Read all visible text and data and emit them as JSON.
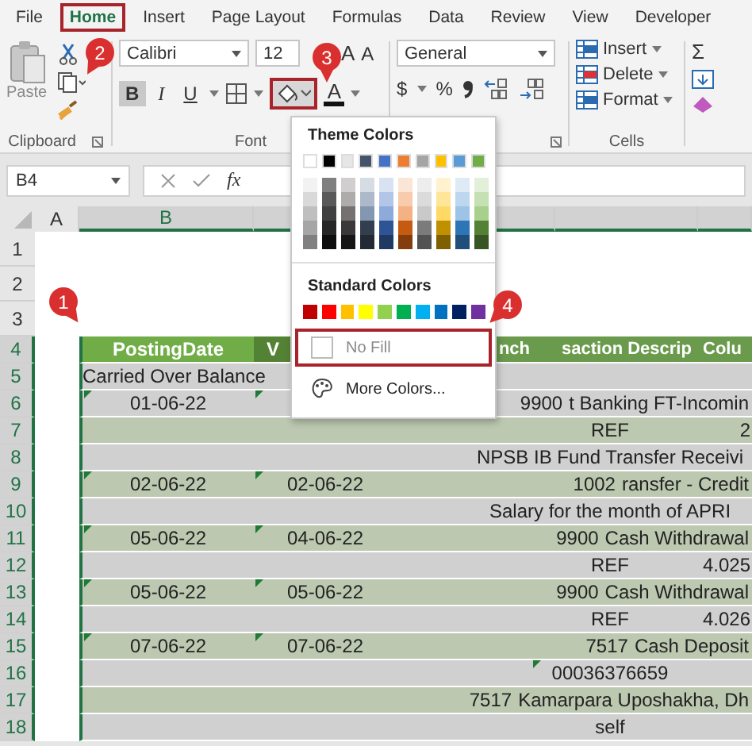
{
  "tabs": [
    {
      "label": "File",
      "selected": false,
      "highlighted": false
    },
    {
      "label": "Home",
      "selected": true,
      "highlighted": true
    },
    {
      "label": "Insert",
      "selected": false,
      "highlighted": false
    },
    {
      "label": "Page Layout",
      "selected": false,
      "highlighted": false
    },
    {
      "label": "Formulas",
      "selected": false,
      "highlighted": false
    },
    {
      "label": "Data",
      "selected": false,
      "highlighted": false
    },
    {
      "label": "Review",
      "selected": false,
      "highlighted": false
    },
    {
      "label": "View",
      "selected": false,
      "highlighted": false
    },
    {
      "label": "Developer",
      "selected": false,
      "highlighted": false
    }
  ],
  "clipboard": {
    "paste": "Paste",
    "label": "Clipboard"
  },
  "font": {
    "name": "Calibri",
    "size": "12",
    "grow": "A",
    "shrink": "A",
    "bold": "B",
    "italic": "I",
    "underline": "U",
    "fill_highlighted": true,
    "color_letter": "A",
    "label": "Font"
  },
  "number": {
    "format": "General",
    "currency": "$",
    "percent": "%"
  },
  "cells": {
    "items": [
      "Insert",
      "Delete",
      "Format"
    ],
    "label": "Cells"
  },
  "editing": {
    "sum": "Σ"
  },
  "formula_bar": {
    "name_box": "B4",
    "fx": "fx"
  },
  "column_headers": [
    "A",
    "B"
  ],
  "rows": [
    {
      "num": "1",
      "kind": "blank",
      "selected": false
    },
    {
      "num": "2",
      "kind": "blank",
      "selected": false
    },
    {
      "num": "3",
      "kind": "blank",
      "selected": false
    },
    {
      "num": "4",
      "kind": "header",
      "selected": true,
      "b": "PostingDate",
      "c": "V",
      "d": "nch",
      "e": "saction Descrip",
      "f": "Colu"
    },
    {
      "num": "5",
      "kind": "data",
      "selected": true,
      "band": false,
      "b": "Carried Over Balance"
    },
    {
      "num": "6",
      "kind": "data",
      "selected": true,
      "band": false,
      "b": "01-06-22",
      "d": "9900",
      "e": "t Banking FT-Incomin",
      "flag_b": true,
      "flag_c": true
    },
    {
      "num": "7",
      "kind": "data",
      "selected": true,
      "band": true,
      "e": "REF",
      "f": "2"
    },
    {
      "num": "8",
      "kind": "data",
      "selected": true,
      "band": false,
      "e": "NPSB IB Fund Transfer Receivi"
    },
    {
      "num": "9",
      "kind": "data",
      "selected": true,
      "band": true,
      "b": "02-06-22",
      "c": "02-06-22",
      "d": "1002",
      "e": "ransfer - Credit",
      "flag_b": true,
      "flag_c": true
    },
    {
      "num": "10",
      "kind": "data",
      "selected": true,
      "band": false,
      "e": "Salary for the month of APRI"
    },
    {
      "num": "11",
      "kind": "data",
      "selected": true,
      "band": true,
      "b": "05-06-22",
      "c": "04-06-22",
      "d": "9900",
      "e": "Cash Withdrawal",
      "flag_b": true,
      "flag_c": true
    },
    {
      "num": "12",
      "kind": "data",
      "selected": true,
      "band": false,
      "e": "REF",
      "f": "4.025"
    },
    {
      "num": "13",
      "kind": "data",
      "selected": true,
      "band": true,
      "b": "05-06-22",
      "c": "05-06-22",
      "d": "9900",
      "e": "Cash Withdrawal",
      "flag_b": true,
      "flag_c": true
    },
    {
      "num": "14",
      "kind": "data",
      "selected": true,
      "band": false,
      "e": "REF",
      "f": "4.026"
    },
    {
      "num": "15",
      "kind": "data",
      "selected": true,
      "band": true,
      "b": "07-06-22",
      "c": "07-06-22",
      "d": "7517",
      "e": "Cash Deposit",
      "flag_b": true,
      "flag_c": true
    },
    {
      "num": "16",
      "kind": "data",
      "selected": true,
      "band": false,
      "e": "00036376659",
      "flag_e": true
    },
    {
      "num": "17",
      "kind": "data",
      "selected": true,
      "band": true,
      "d": "7517",
      "e": "Kamarpara Uposhakha, Dh"
    },
    {
      "num": "18",
      "kind": "data",
      "selected": true,
      "band": false,
      "e": "self"
    }
  ],
  "fill_menu": {
    "title": "Theme Colors",
    "theme": [
      {
        "color": "#ffffff",
        "shades": [
          {
            "color": "#f2f2f2"
          },
          {
            "color": "#d9d9d9"
          },
          {
            "color": "#bfbfbf"
          },
          {
            "color": "#a6a6a6"
          },
          {
            "color": "#808080"
          }
        ]
      },
      {
        "color": "#000000",
        "shades": [
          {
            "color": "#7f7f7f"
          },
          {
            "color": "#595959"
          },
          {
            "color": "#404040"
          },
          {
            "color": "#262626"
          },
          {
            "color": "#0d0d0d"
          }
        ]
      },
      {
        "color": "#e7e6e6",
        "shades": [
          {
            "color": "#d0cece"
          },
          {
            "color": "#aeabab"
          },
          {
            "color": "#757171"
          },
          {
            "color": "#3a3838"
          },
          {
            "color": "#171616"
          }
        ]
      },
      {
        "color": "#44546a",
        "shades": [
          {
            "color": "#d6dce4"
          },
          {
            "color": "#adb9ca"
          },
          {
            "color": "#8497b0"
          },
          {
            "color": "#333f4f"
          },
          {
            "color": "#222a35"
          }
        ]
      },
      {
        "color": "#4472c4",
        "shades": [
          {
            "color": "#d9e2f3"
          },
          {
            "color": "#b4c6e7"
          },
          {
            "color": "#8eaadb"
          },
          {
            "color": "#2f5496"
          },
          {
            "color": "#1f3864"
          }
        ]
      },
      {
        "color": "#ed7d31",
        "shades": [
          {
            "color": "#fbe5d5"
          },
          {
            "color": "#f7cbac"
          },
          {
            "color": "#f4b183"
          },
          {
            "color": "#c55a11"
          },
          {
            "color": "#833c0b"
          }
        ]
      },
      {
        "color": "#a5a5a5",
        "shades": [
          {
            "color": "#ededed"
          },
          {
            "color": "#dbdbdb"
          },
          {
            "color": "#c9c9c9"
          },
          {
            "color": "#7b7b7b"
          },
          {
            "color": "#525252"
          }
        ]
      },
      {
        "color": "#ffc000",
        "shades": [
          {
            "color": "#fff2cc"
          },
          {
            "color": "#fee599"
          },
          {
            "color": "#ffd965"
          },
          {
            "color": "#bf9000"
          },
          {
            "color": "#7f6000"
          }
        ]
      },
      {
        "color": "#5b9bd5",
        "shades": [
          {
            "color": "#deebf6"
          },
          {
            "color": "#bdd7ee"
          },
          {
            "color": "#9dc3e6"
          },
          {
            "color": "#2e75b5"
          },
          {
            "color": "#1e4e79"
          }
        ]
      },
      {
        "color": "#70ad47",
        "shades": [
          {
            "color": "#e2efd9"
          },
          {
            "color": "#c5e0b3"
          },
          {
            "color": "#a8d08d"
          },
          {
            "color": "#538135"
          },
          {
            "color": "#375623"
          }
        ]
      }
    ],
    "standard_title": "Standard Colors",
    "standard": [
      {
        "color": "#c00000"
      },
      {
        "color": "#ff0000"
      },
      {
        "color": "#ffc000"
      },
      {
        "color": "#ffff00"
      },
      {
        "color": "#92d050"
      },
      {
        "color": "#00b050"
      },
      {
        "color": "#00b0f0"
      },
      {
        "color": "#0070c0"
      },
      {
        "color": "#002060"
      },
      {
        "color": "#7030a0"
      }
    ],
    "no_fill": {
      "label": "No Fill",
      "disabled": true,
      "highlighted": true
    },
    "more": "More Colors..."
  },
  "callouts": [
    "1",
    "2",
    "3",
    "4"
  ]
}
